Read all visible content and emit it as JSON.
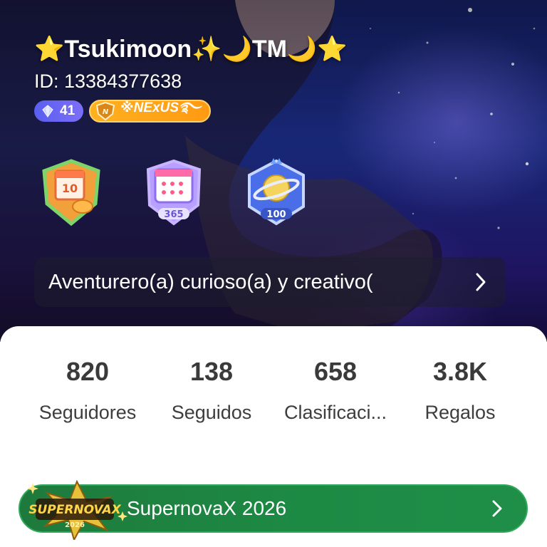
{
  "profile": {
    "display_name": "⭐Tsukimoon✨🌙TM🌙⭐",
    "id_text": "ID: 13384377638",
    "diamond_level": "41",
    "nexus_badge": "※NExUS࿐"
  },
  "medals": [
    {
      "name": "calendar-check-in-medal",
      "label": "10"
    },
    {
      "name": "calendar-365-medal",
      "label": "365"
    },
    {
      "name": "planet-100-medal",
      "label": "100"
    }
  ],
  "bio": {
    "text": "Aventurero(a) curioso(a) y creativo("
  },
  "stats": [
    {
      "value": "820",
      "label": "Seguidores"
    },
    {
      "value": "138",
      "label": "Seguidos"
    },
    {
      "value": "658",
      "label": "Clasificaci..."
    },
    {
      "value": "3.8K",
      "label": "Regalos"
    }
  ],
  "event": {
    "logo_text": "SUPERNOVAX",
    "logo_year": "2026",
    "label": "SupernovaX 2026"
  },
  "colors": {
    "event_green": "#1d8a44",
    "diamond_purple": "#6a66f2",
    "nexus_orange": "#ffa51a"
  }
}
